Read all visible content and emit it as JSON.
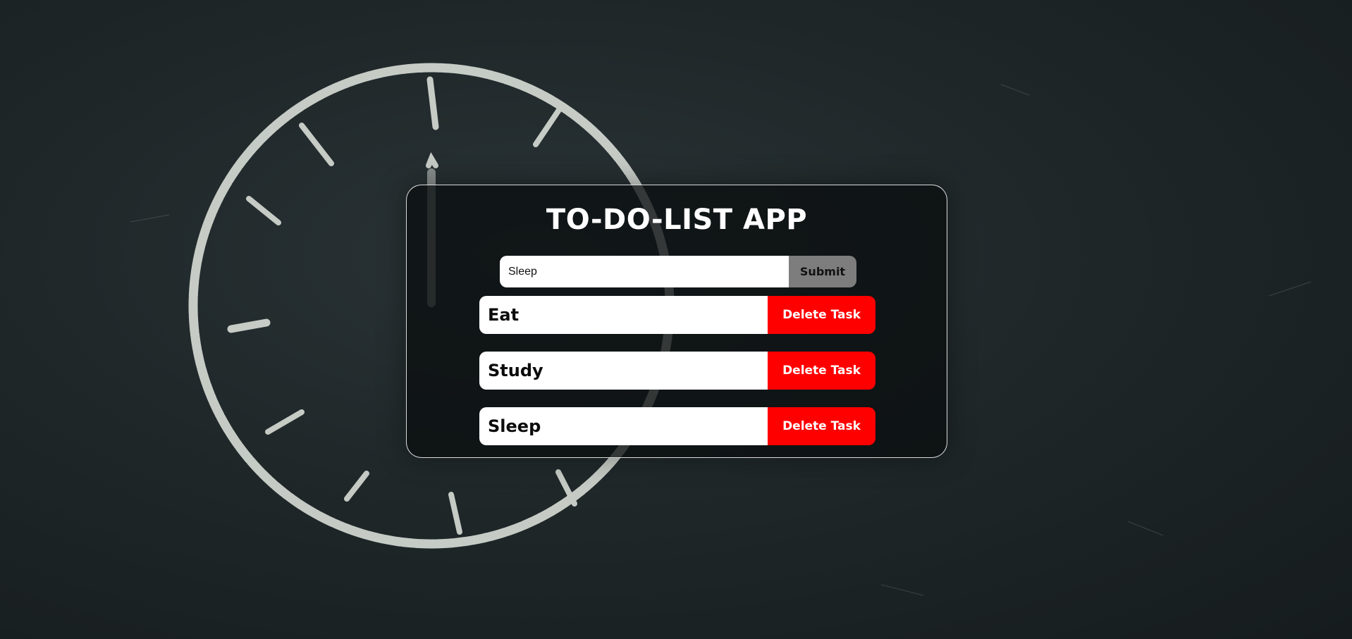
{
  "app": {
    "title": "TO-DO-LIST APP"
  },
  "form": {
    "input_value": "Sleep",
    "submit_label": "Submit"
  },
  "tasks": [
    {
      "text": "Eat",
      "delete_label": "Delete Task"
    },
    {
      "text": "Study",
      "delete_label": "Delete Task"
    },
    {
      "text": "Sleep",
      "delete_label": "Delete Task"
    }
  ],
  "colors": {
    "background": "#1f2729",
    "card_border": "#ffffff",
    "submit_bg": "#7d7d7d",
    "delete_bg": "#ff0000",
    "chalk": "#d9ddd6"
  }
}
